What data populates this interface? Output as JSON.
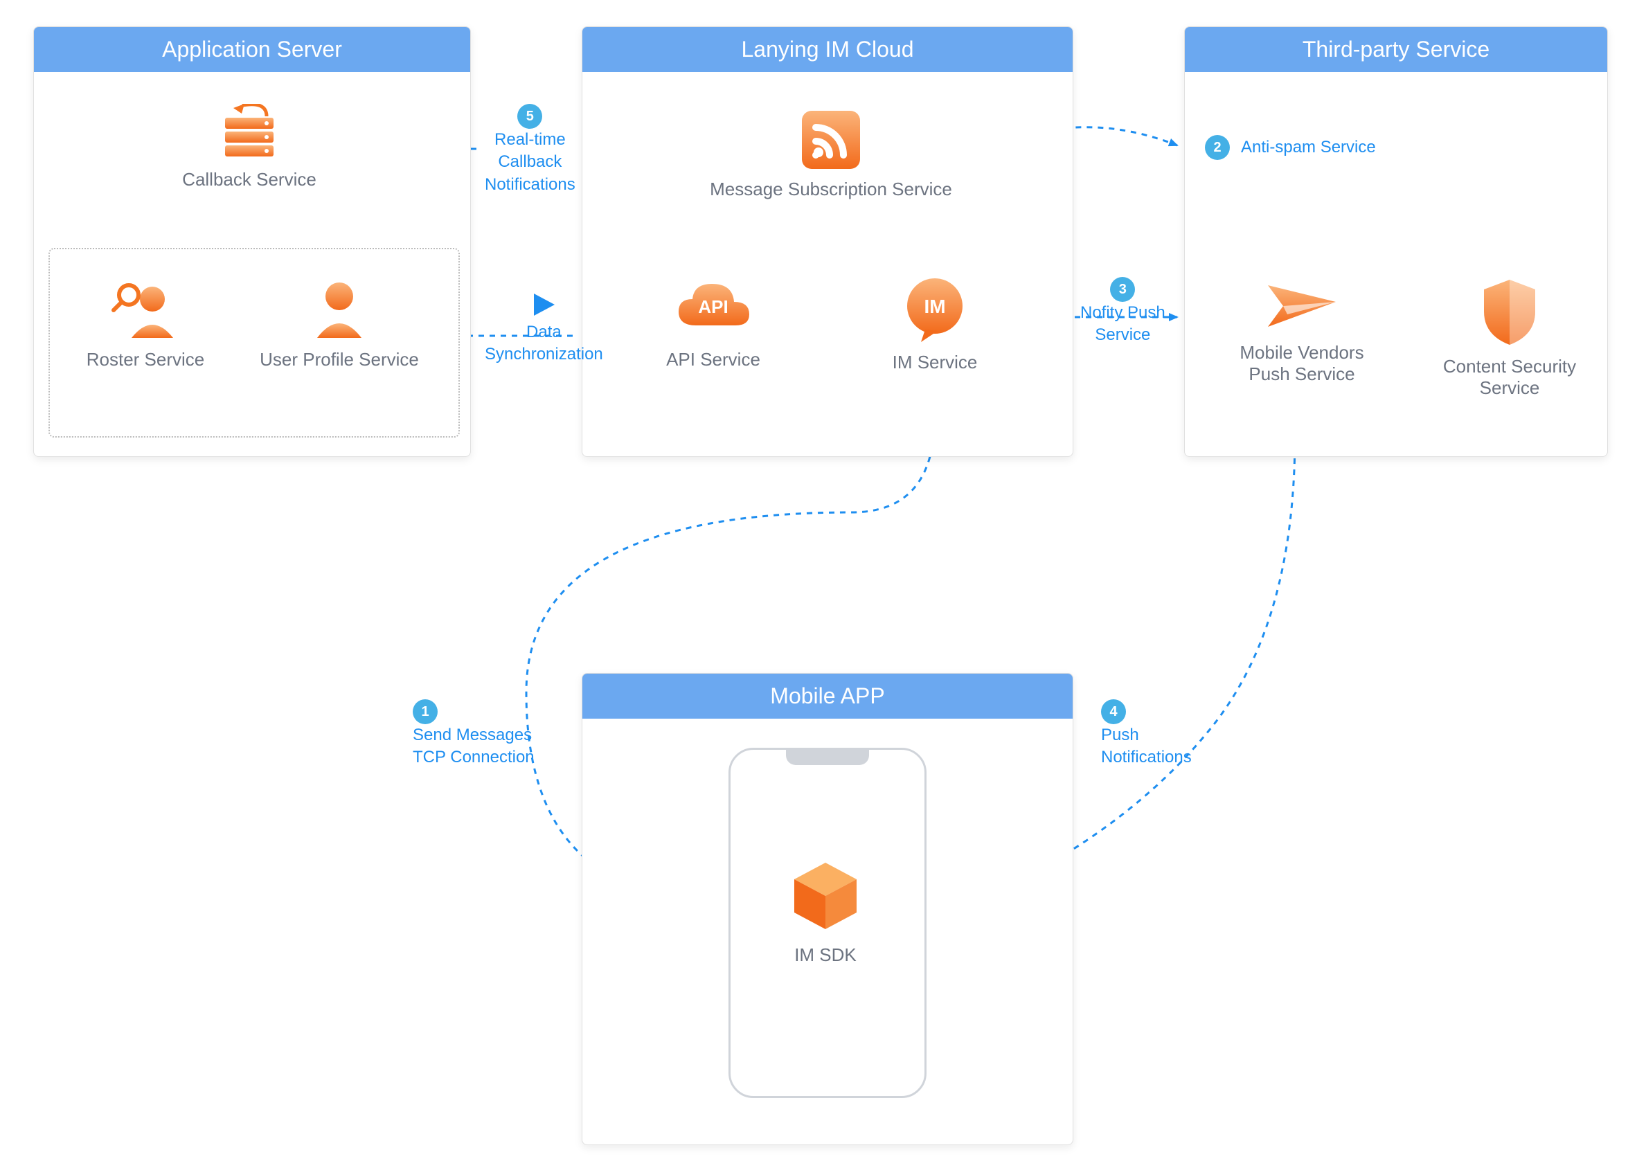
{
  "panels": {
    "app_server": {
      "title": "Application Server",
      "callback": "Callback Service",
      "roster": "Roster Service",
      "user_profile": "User Profile Service"
    },
    "im_cloud": {
      "title": "Lanying IM Cloud",
      "subscription": "Message Subscription Service",
      "api": "API Service",
      "api_badge": "API",
      "im": "IM Service",
      "im_badge": "IM"
    },
    "third_party": {
      "title": "Third-party Service",
      "push": "Mobile Vendors\nPush Service",
      "security": "Content Security\nService"
    },
    "mobile": {
      "title": "Mobile APP",
      "sdk": "IM SDK"
    }
  },
  "steps": {
    "s1": {
      "num": "1",
      "text": "Send Messages\nTCP Connection"
    },
    "s2": {
      "num": "2",
      "text": "Anti-spam Service"
    },
    "s3": {
      "num": "3",
      "text": "Nofity Push\nService"
    },
    "s4": {
      "num": "4",
      "text": "Push\nNotifications"
    },
    "s5": {
      "num": "5",
      "text": "Real-time\nCallback\nNotifications"
    },
    "sync": {
      "text": "Data\nSynchronization"
    }
  },
  "colors": {
    "header": "#6ba8f0",
    "accent": "#f47521",
    "link": "#1e8ef0"
  }
}
